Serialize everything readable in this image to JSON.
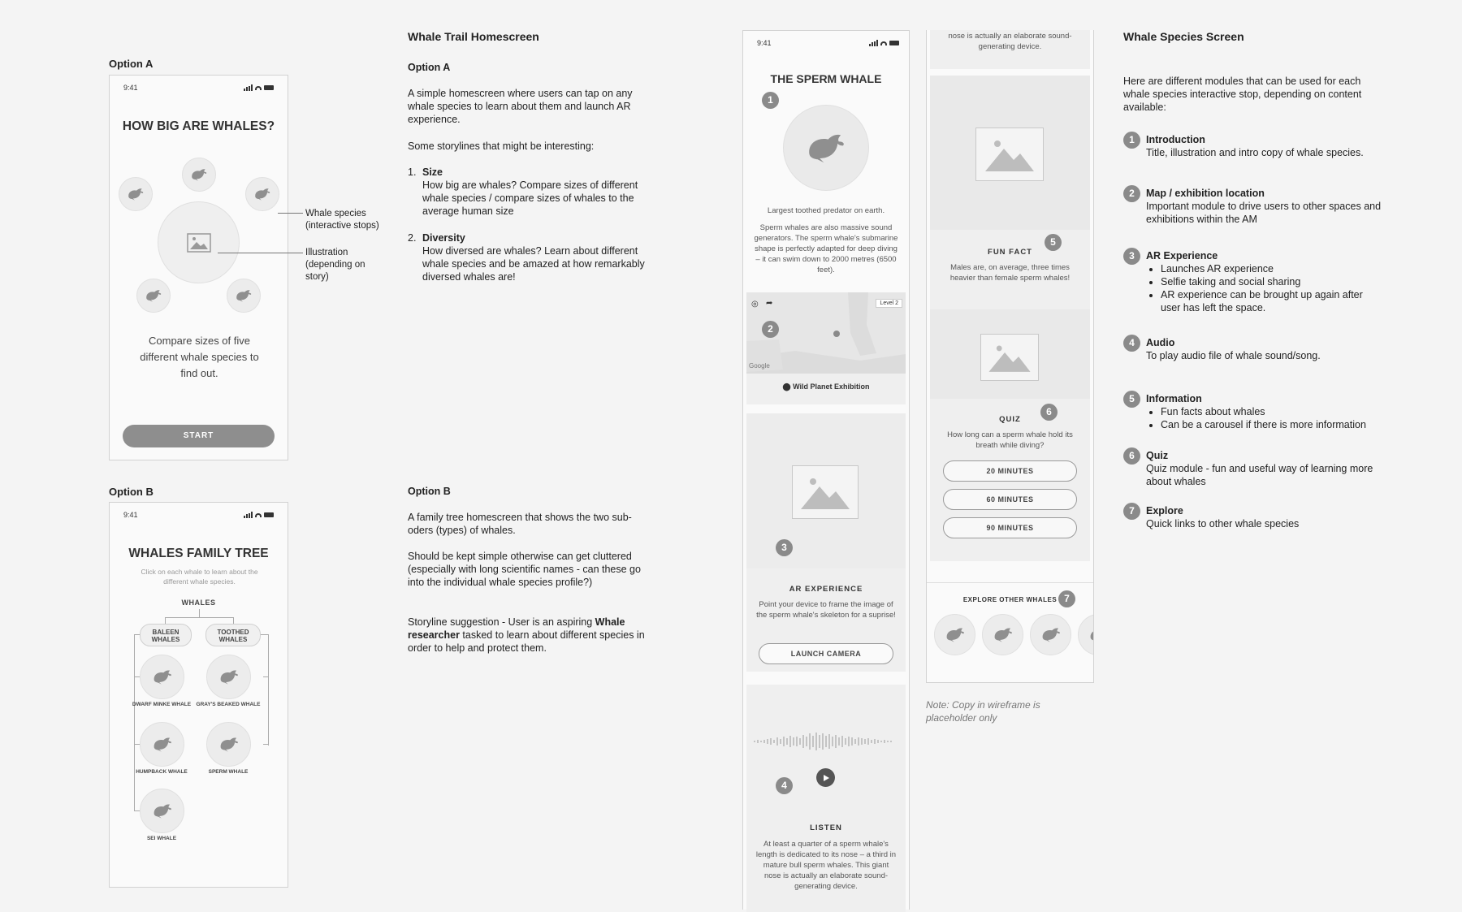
{
  "option_a": {
    "label": "Option A",
    "phone": {
      "time": "9:41",
      "title": "HOW BIG ARE WHALES?",
      "description": "Compare sizes of five different whale species to find out.",
      "start_button": "START"
    },
    "callouts": {
      "species": "Whale species (interactive stops)",
      "illustration": "Illustration (depending on story)"
    }
  },
  "option_b": {
    "label": "Option B",
    "phone": {
      "time": "9:41",
      "title": "WHALES FAMILY TREE",
      "subtitle": "Click on each whale to learn about the different whale species.",
      "root": "WHALES",
      "branches": [
        "BALEEN WHALES",
        "TOOTHED WHALES"
      ],
      "whales": [
        "DWARF MINKE WHALE",
        "GRAY'S BEAKED WHALE",
        "HUMPBACK WHALE",
        "SPERM WHALE",
        "SEI WHALE"
      ]
    }
  },
  "homescreen_notes": {
    "heading": "Whale Trail Homescreen",
    "option_a_label": "Option A",
    "option_a_intro": "A simple homescreen where users can tap on any whale species to learn about them and launch AR experience.",
    "storylines_intro": "Some storylines that might be interesting:",
    "storylines": [
      {
        "num": "1.",
        "title": "Size",
        "body": "How big are whales? Compare sizes of different whale species / compare sizes of whales to the average human size"
      },
      {
        "num": "2.",
        "title": "Diversity",
        "body": "How diversed are whales? Learn about different whale species and be amazed at how remarkably diversed whales are!"
      }
    ],
    "option_b_label": "Option B",
    "option_b_intro": "A family tree homescreen that shows the two sub-oders (types) of whales.",
    "option_b_note": "Should be kept simple otherwise can get cluttered (especially with long scientific names - can these go into the individual whale species profile?)",
    "storyline_prefix": "Storyline suggestion - User is an aspiring ",
    "storyline_bold": "Whale researcher",
    "storyline_suffix": " tasked to learn about different species in order to help and protect them."
  },
  "species_phone": {
    "time": "9:41",
    "title": "THE SPERM WHALE",
    "tagline": "Largest toothed predator on earth.",
    "intro": "Sperm whales are also massive sound generators. The sperm whale's submarine shape is perfectly adapted for deep diving – it can swim down to 2000 metres (6500 feet).",
    "map_level": "Level 2",
    "map_google": "Google",
    "map_location": "Wild Planet Exhibition",
    "ar_title": "AR EXPERIENCE",
    "ar_body": "Point your device to frame the image of the sperm whale's skeleton for a suprise!",
    "ar_button": "LAUNCH CAMERA",
    "listen_title": "LISTEN",
    "listen_body": "At least a quarter of a sperm whale's length is dedicated to its nose – a third in mature bull sperm whales. This giant nose is actually an elaborate sound-generating device."
  },
  "species_phone_2": {
    "top_text": "nose is actually an elaborate sound-generating device.",
    "fact_title": "FUN FACT",
    "fact_body": "Males are, on average, three times heavier than female sperm whales!",
    "quiz_title": "QUIZ",
    "quiz_question": "How long can a sperm whale hold its breath while diving?",
    "quiz_options": [
      "20 MINUTES",
      "60 MINUTES",
      "90 MINUTES"
    ],
    "explore_title": "EXPLORE OTHER WHALES",
    "note": "Note: Copy in wireframe is placeholder only"
  },
  "markers": [
    "1",
    "2",
    "3",
    "4",
    "5",
    "6",
    "7"
  ],
  "species_notes": {
    "heading": "Whale Species Screen",
    "intro": "Here are different modules that can be used for each whale species interactive stop, depending on content available:",
    "items": [
      {
        "num": "1",
        "title": "Introduction",
        "body": "Title, illustration and intro copy of whale species.",
        "bullets": []
      },
      {
        "num": "2",
        "title": "Map / exhibition location",
        "body": "Important module to drive users to other spaces and exhibitions within the AM",
        "bullets": []
      },
      {
        "num": "3",
        "title": "AR Experience",
        "body": "",
        "bullets": [
          "Launches AR experience",
          "Selfie taking and social sharing",
          "AR experience can be brought up again after user has left the space."
        ]
      },
      {
        "num": "4",
        "title": "Audio",
        "body": "To play audio file of whale sound/song.",
        "bullets": []
      },
      {
        "num": "5",
        "title": "Information",
        "body": "",
        "bullets": [
          "Fun facts about whales",
          "Can be a carousel if there is more information"
        ]
      },
      {
        "num": "6",
        "title": "Quiz",
        "body": "Quiz module - fun and useful way of learning more about whales",
        "bullets": []
      },
      {
        "num": "7",
        "title": "Explore",
        "body": "Quick links to other whale species",
        "bullets": []
      }
    ]
  }
}
